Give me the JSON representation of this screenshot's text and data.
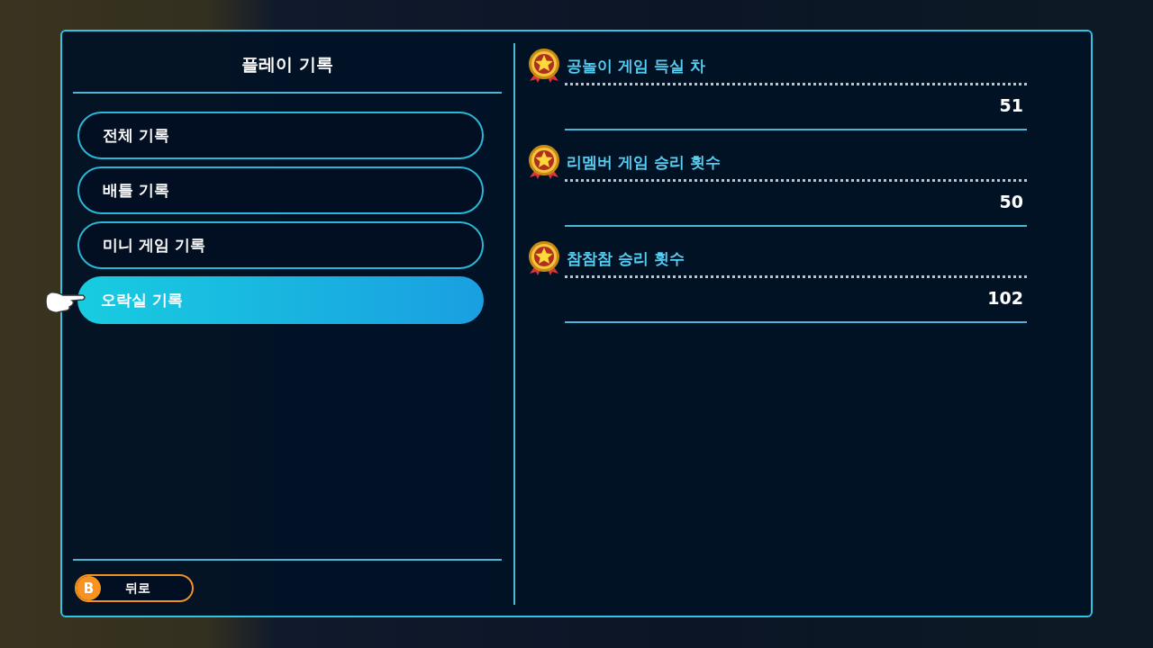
{
  "panel": {
    "title": "플레이 기록"
  },
  "menu": [
    {
      "label": "전체 기록",
      "selected": false
    },
    {
      "label": "배틀 기록",
      "selected": false
    },
    {
      "label": "미니 게임 기록",
      "selected": false
    },
    {
      "label": "오락실 기록",
      "selected": true
    }
  ],
  "back_button": {
    "key": "B",
    "label": "뒤로"
  },
  "records": [
    {
      "title": "공놀이 게임 득실 차",
      "value": "51"
    },
    {
      "title": "리멤버 게임 승리 횟수",
      "value": "50"
    },
    {
      "title": "참참참 승리 횟수",
      "value": "102"
    }
  ]
}
